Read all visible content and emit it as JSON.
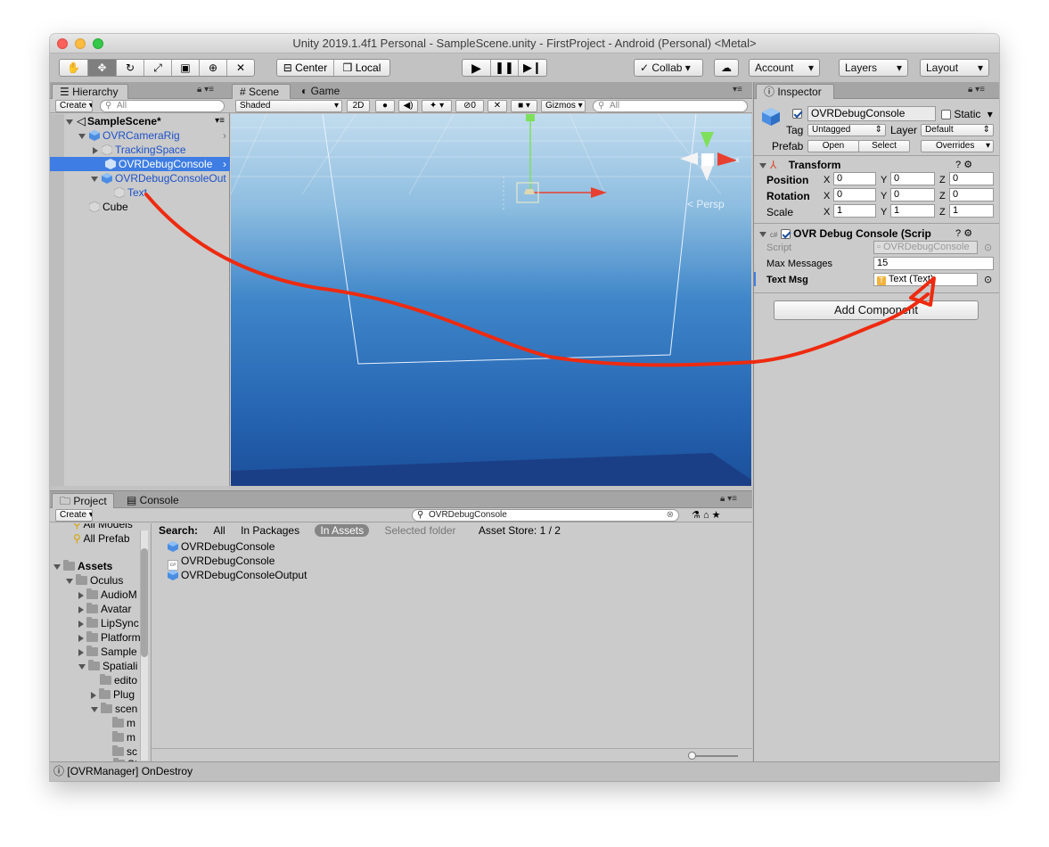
{
  "window": {
    "title": "Unity 2019.1.4f1 Personal - SampleScene.unity - FirstProject - Android (Personal) <Metal>"
  },
  "toolbar": {
    "pivot": "Center",
    "space": "Local",
    "collab": "Collab",
    "account": "Account",
    "layers": "Layers",
    "layout": "Layout"
  },
  "hierarchy": {
    "tab": "Hierarchy",
    "create": "Create",
    "search_placeholder": "All",
    "items": [
      {
        "label": "SampleScene*"
      },
      {
        "label": "OVRCameraRig"
      },
      {
        "label": "TrackingSpace"
      },
      {
        "label": "OVRDebugConsole"
      },
      {
        "label": "OVRDebugConsoleOut"
      },
      {
        "label": "Text"
      },
      {
        "label": "Cube"
      }
    ]
  },
  "scene": {
    "tab_scene": "Scene",
    "tab_game": "Game",
    "shading": "Shaded",
    "mode2d": "2D",
    "hidden_count": "0",
    "gizmos": "Gizmos",
    "search_placeholder": "All",
    "persp": "< Persp",
    "gizmo_axis": "x"
  },
  "inspector": {
    "tab": "Inspector",
    "object_name": "OVRDebugConsole",
    "static": "Static",
    "tag_label": "Tag",
    "tag_value": "Untagged",
    "layer_label": "Layer",
    "layer_value": "Default",
    "prefab_label": "Prefab",
    "prefab_open": "Open",
    "prefab_select": "Select",
    "prefab_overrides": "Overrides",
    "transform": {
      "title": "Transform",
      "rows": [
        {
          "label": "Position",
          "x": "0",
          "y": "0",
          "z": "0"
        },
        {
          "label": "Rotation",
          "x": "0",
          "y": "0",
          "z": "0"
        },
        {
          "label": "Scale",
          "x": "1",
          "y": "1",
          "z": "1"
        }
      ],
      "axis_x": "X",
      "axis_y": "Y",
      "axis_z": "Z"
    },
    "component": {
      "title": "OVR Debug Console (Scrip",
      "script_label": "Script",
      "script_value": "OVRDebugConsole",
      "max_label": "Max Messages",
      "max_value": "15",
      "textmsg_label": "Text Msg",
      "textmsg_value": "Text (Text)"
    },
    "add_component": "Add Component"
  },
  "project": {
    "tab_project": "Project",
    "tab_console": "Console",
    "create": "Create",
    "search_value": "OVRDebugConsole",
    "search_label": "Search:",
    "filter_all": "All",
    "filter_packages": "In Packages",
    "filter_assets": "In Assets",
    "filter_folder": "Selected folder",
    "asset_store": "Asset Store: 1 / 2",
    "tree": [
      {
        "label": "All Models"
      },
      {
        "label": "All Prefab"
      },
      {
        "label": "Assets"
      },
      {
        "label": "Oculus"
      },
      {
        "label": "AudioM"
      },
      {
        "label": "Avatar"
      },
      {
        "label": "LipSync"
      },
      {
        "label": "Platform"
      },
      {
        "label": "Sample"
      },
      {
        "label": "Spatiali"
      },
      {
        "label": "edito"
      },
      {
        "label": "Plug"
      },
      {
        "label": "scen"
      },
      {
        "label": "m"
      },
      {
        "label": "m"
      },
      {
        "label": "sc"
      },
      {
        "label": "St"
      }
    ],
    "results": [
      {
        "label": "OVRDebugConsole"
      },
      {
        "label": "OVRDebugConsole"
      },
      {
        "label": "OVRDebugConsoleOutput"
      }
    ]
  },
  "status": {
    "message": "[OVRManager] OnDestroy"
  },
  "colors": {
    "selection": "#3e7de3",
    "annotation": "#ee2a10",
    "sky_top": "#b8d6ea",
    "sky_bottom": "#1e5fae"
  }
}
